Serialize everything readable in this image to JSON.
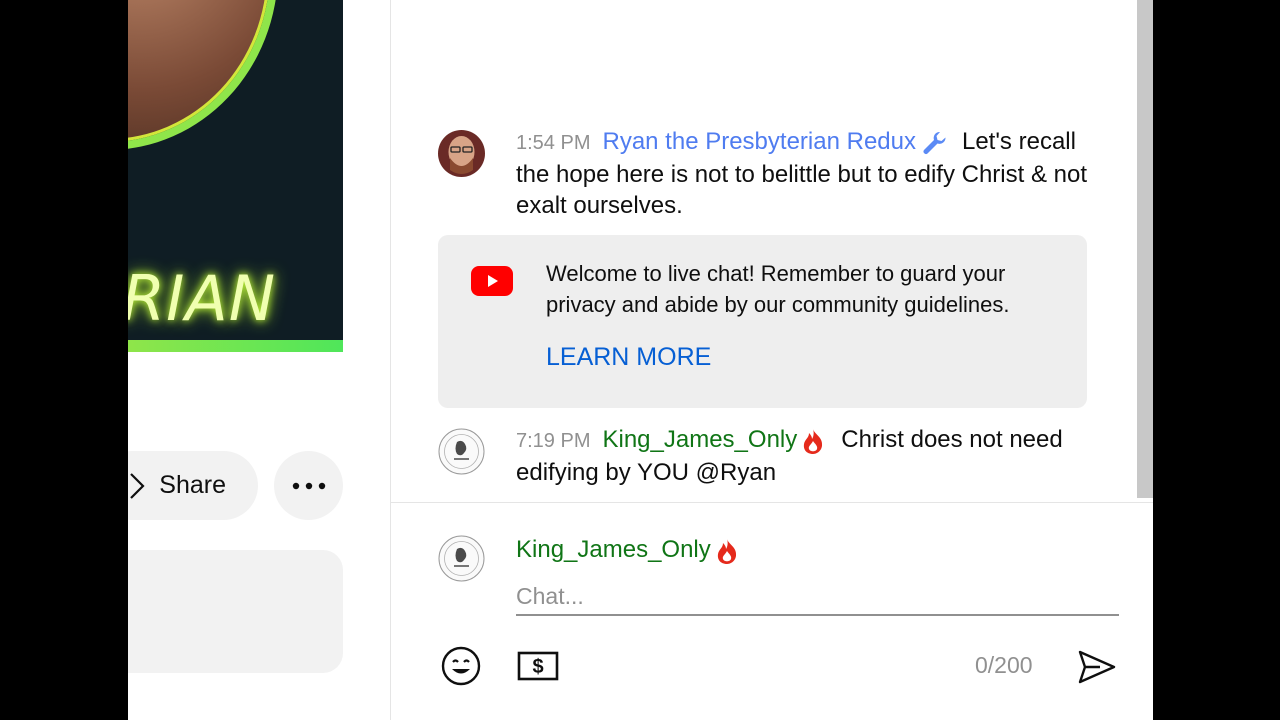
{
  "video": {
    "thumbnail_text": "RIAN",
    "share_label": "Share"
  },
  "chat": {
    "messages": [
      {
        "time": "1:54 PM",
        "author": "Ryan the Presbyterian Redux",
        "badge_icon": "wrench-icon",
        "text": "Let's recall the hope here is not to belittle but to edify Christ & not exalt ourselves."
      },
      {
        "time": "7:19 PM",
        "author": "King_James_Only",
        "badge_icon": "fire-icon",
        "text": "Christ does not need edifying by YOU @Ryan"
      }
    ],
    "welcome": {
      "text": "Welcome to live chat! Remember to guard your privacy and abide by our community guidelines.",
      "link": "LEARN MORE"
    },
    "composer": {
      "username": "King_James_Only",
      "placeholder": "Chat...",
      "counter": "0/200"
    }
  },
  "colors": {
    "moderator_name": "#4f7cf0",
    "member_name": "#107516",
    "link": "#065fd4",
    "youtube_red": "#ff0000"
  }
}
